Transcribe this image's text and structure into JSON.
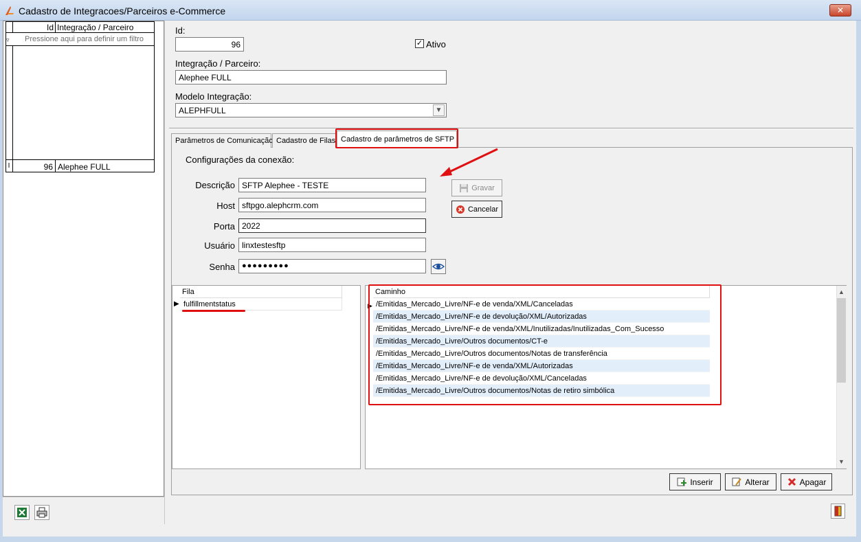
{
  "window": {
    "title": "Cadastro de Integracoes/Parceiros e-Commerce",
    "close_label": "✕"
  },
  "left_grid": {
    "header_id": "Id",
    "header_name": "Integração / Parceiro",
    "filter_hint": "Pressione aqui para definir um filtro",
    "rows": [
      {
        "id": "96",
        "name": "Alephee FULL"
      }
    ]
  },
  "form": {
    "id_label": "Id:",
    "id_value": "96",
    "ativo_label": "Ativo",
    "ativo_checked": true,
    "integ_label": "Integração / Parceiro:",
    "integ_value": "Alephee FULL",
    "modelo_label": "Modelo Integração:",
    "modelo_value": "ALEPHFULL"
  },
  "tabs": [
    {
      "label": "Parâmetros de Comunicação"
    },
    {
      "label": "Cadastro de Filas"
    },
    {
      "label": "Cadastro de parâmetros de SFTP",
      "active": true
    }
  ],
  "sftp": {
    "section_title": "Configurações da conexão:",
    "descricao_label": "Descrição",
    "descricao_value": "SFTP Alephee - TESTE",
    "host_label": "Host",
    "host_value": "sftpgo.alephcrm.com",
    "porta_label": "Porta",
    "porta_value": "2022",
    "usuario_label": "Usuário",
    "usuario_value": "linxtestesftp",
    "senha_label": "Senha",
    "senha_value": "●●●●●●●●●",
    "gravar_label": "Gravar",
    "cancelar_label": "Cancelar"
  },
  "fila_grid": {
    "header": "Fila",
    "rows": [
      "fulfillmentstatus"
    ]
  },
  "caminho_grid": {
    "header": "Caminho",
    "rows": [
      "/Emitidas_Mercado_Livre/NF-e de venda/XML/Canceladas",
      "/Emitidas_Mercado_Livre/NF-e de devolução/XML/Autorizadas",
      "/Emitidas_Mercado_Livre/NF-e de venda/XML/Inutilizadas/Inutilizadas_Com_Sucesso",
      "/Emitidas_Mercado_Livre/Outros documentos/CT-e",
      "/Emitidas_Mercado_Livre/Outros documentos/Notas de transferência",
      "/Emitidas_Mercado_Livre/NF-e de venda/XML/Autorizadas",
      "/Emitidas_Mercado_Livre/NF-e de devolução/XML/Canceladas",
      "/Emitidas_Mercado_Livre/Outros documentos/Notas de retiro simbólica"
    ]
  },
  "buttons": {
    "inserir": "Inserir",
    "alterar": "Alterar",
    "apagar": "Apagar"
  },
  "colors": {
    "highlight": "#e01010",
    "alt_row": "#e3eefb"
  }
}
